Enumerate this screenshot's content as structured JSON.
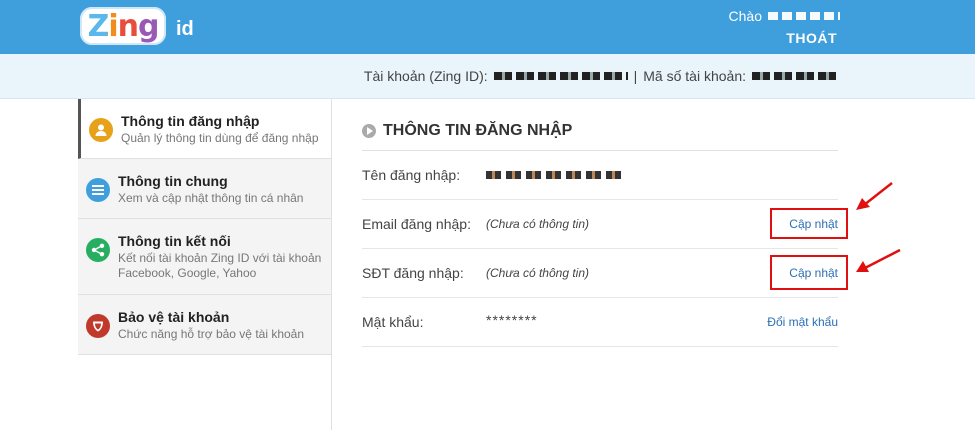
{
  "header": {
    "logo_text": "Zing",
    "logo_suffix": "id",
    "greeting": "Chào",
    "logout_label": "THOÁT"
  },
  "account_bar": {
    "account_label": "Tài khoản (Zing ID):",
    "separator": "|",
    "id_label": "Mã số tài khoản:"
  },
  "sidebar": {
    "items": [
      {
        "title": "Thông tin đăng nhập",
        "subtitle": "Quản lý thông tin dùng để đăng nhập",
        "icon": "user-icon",
        "color": "#e8a21a"
      },
      {
        "title": "Thông tin chung",
        "subtitle": "Xem và cập nhật thông tin cá nhân",
        "icon": "list-icon",
        "color": "#3f9fdc"
      },
      {
        "title": "Thông tin kết nối",
        "subtitle": "Kết nối tài khoản Zing ID với tài khoản Facebook, Google, Yahoo",
        "icon": "share-icon",
        "color": "#27ae60"
      },
      {
        "title": "Bảo vệ tài khoản",
        "subtitle": "Chức năng hỗ trợ bảo vệ tài khoản",
        "icon": "shield-icon",
        "color": "#c0392b"
      }
    ]
  },
  "main": {
    "title": "THÔNG TIN ĐĂNG NHẬP",
    "rows": [
      {
        "label": "Tên đăng nhập:",
        "value": "",
        "action": ""
      },
      {
        "label": "Email đăng nhập:",
        "value": "(Chưa có thông tin)",
        "action": "Cập nhật"
      },
      {
        "label": "SĐT đăng nhập:",
        "value": "(Chưa có thông tin)",
        "action": "Cập nhật"
      },
      {
        "label": "Mật khẩu:",
        "value": "********",
        "action": "Đổi mật khẩu"
      }
    ]
  },
  "colors": {
    "header_bg": "#3f9fdc",
    "link": "#2b6fb3",
    "highlight": "#e01010"
  }
}
